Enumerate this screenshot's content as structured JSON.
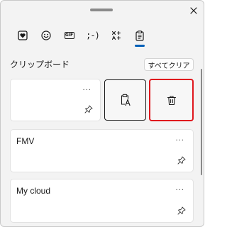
{
  "header": {
    "tabs": [
      {
        "name": "recent-emoji",
        "icon": "heart-sticker-icon"
      },
      {
        "name": "emoji",
        "icon": "smiley-icon"
      },
      {
        "name": "gif",
        "icon": "gif-icon",
        "label": "GIF"
      },
      {
        "name": "kaomoji",
        "icon": "kaomoji-icon",
        "label": ";-)"
      },
      {
        "name": "symbols",
        "icon": "symbols-icon"
      },
      {
        "name": "clipboard",
        "icon": "clipboard-icon",
        "active": true
      }
    ]
  },
  "clipboard": {
    "title": "クリップボード",
    "clear_all_label": "すべてクリア",
    "items": [
      {
        "text": "",
        "more_label": "..."
      },
      {
        "text": "FMV",
        "more_label": "..."
      },
      {
        "text": "My cloud",
        "more_label": "..."
      }
    ]
  },
  "colors": {
    "accent": "#005fb8",
    "highlight_border": "#e0161d",
    "panel_bg": "#f3f3f3"
  }
}
